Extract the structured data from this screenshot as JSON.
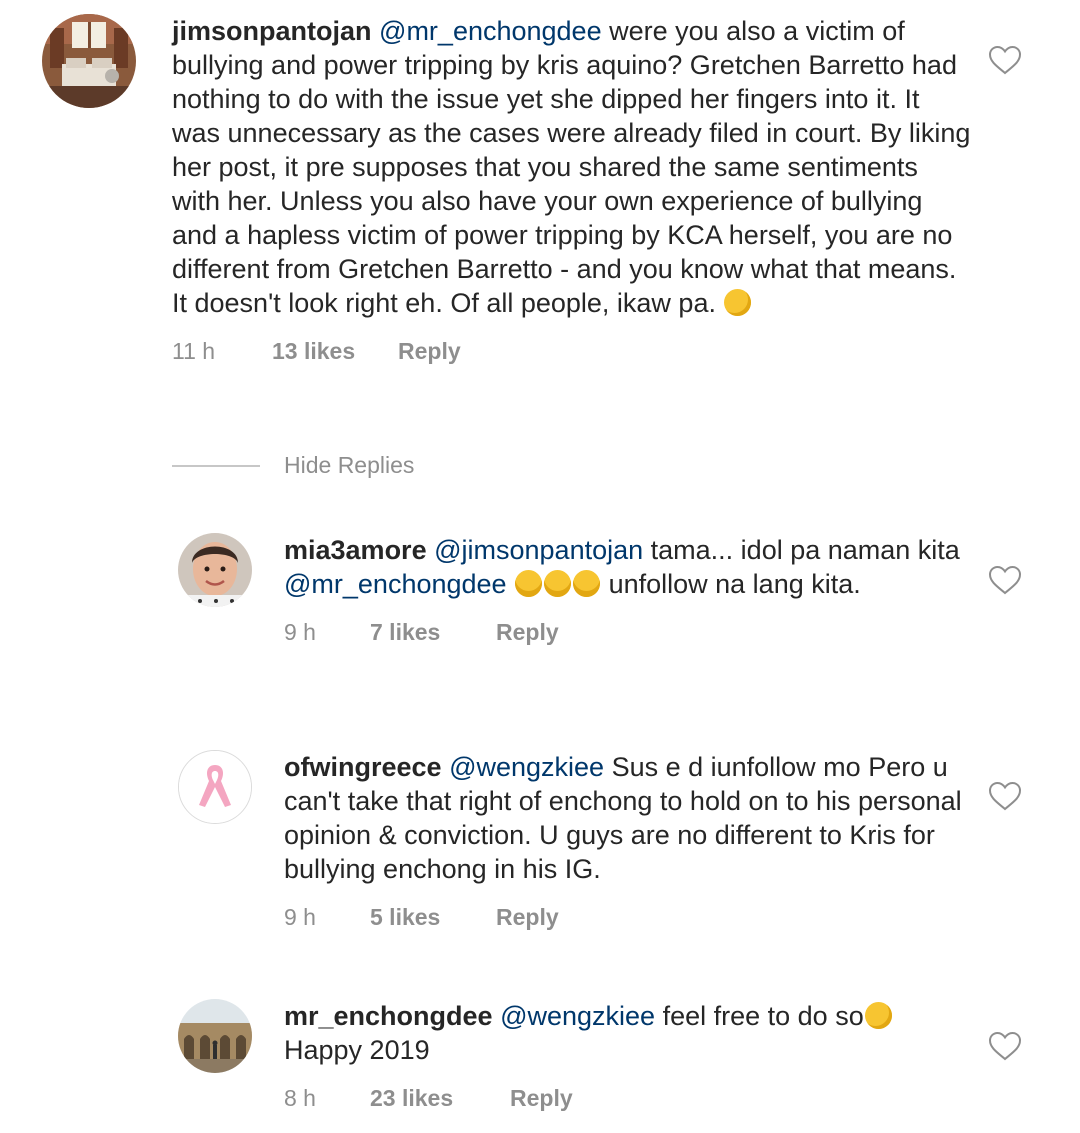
{
  "comments": [
    {
      "username": "jimsonpantojan",
      "mention": "@mr_enchongdee",
      "text": " were you also a victim of bullying and power tripping by kris aquino? Gretchen Barretto had nothing to do with the issue yet she dipped her fingers into it. It was unnecessary as the cases were already filed in court. By liking her post, it pre supposes that you shared the same sentiments with her. Unless you also have your own experience of bullying and a hapless victim of power tripping by KCA herself, you are no different from Gretchen Barretto - and you know what that means. It doesn't look right eh. Of all people, ikaw pa. ",
      "emoji_icon": "thinking-face-emoji",
      "time": "11 h",
      "likes": "13 likes",
      "reply": "Reply"
    },
    {
      "username": "mia3amore",
      "mention": "@jimsonpantojan",
      "text": " tama... idol pa naman kita ",
      "mention2": "@mr_enchongdee",
      "text2": " unfollow na lang kita.",
      "emoji_icon": "tears-of-joy-emoji",
      "emoji_count": 3,
      "time": "9 h",
      "likes": "7 likes",
      "reply": "Reply"
    },
    {
      "username": "ofwingreece",
      "mention": "@wengzkiee",
      "text": " Sus e d iunfollow mo Pero u can't take that right of enchong to hold on to his personal opinion & conviction. U guys are no different to Kris for bullying enchong in his IG.",
      "avatar_icon": "pink-ribbon-icon",
      "time": "9 h",
      "likes": "5 likes",
      "reply": "Reply"
    },
    {
      "username": "mr_enchongdee",
      "mention": "@wengzkiee",
      "text": " feel free to do so",
      "text2": "Happy 2019",
      "emoji_icon": "smiling-face-emoji",
      "time": "8 h",
      "likes": "23 likes",
      "reply": "Reply"
    }
  ],
  "hide_replies": "Hide Replies",
  "icons": {
    "like": "heart-outline-icon"
  },
  "colors": {
    "text": "#262626",
    "mention": "#00376b",
    "meta": "#8e8e8e",
    "ribbon": "#f4a6c1"
  }
}
